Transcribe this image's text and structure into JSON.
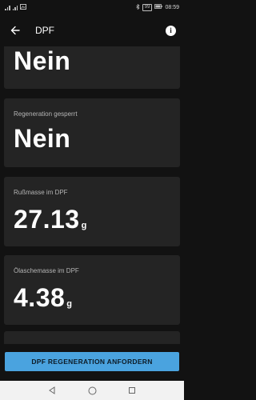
{
  "status_bar": {
    "battery": "99",
    "time": "08:59"
  },
  "app_bar": {
    "title": "DPF",
    "back_icon": "arrow-left-icon",
    "info_icon": "info-icon"
  },
  "cards": [
    {
      "label": "",
      "value": "Nein",
      "unit": ""
    },
    {
      "label": "Regeneration gesperrt",
      "value": "Nein",
      "unit": ""
    },
    {
      "label": "Rußmasse im DPF",
      "value": "27.13",
      "unit": "g"
    },
    {
      "label": "Ölaschemasse im DPF",
      "value": "4.38",
      "unit": "g"
    }
  ],
  "action": {
    "label": "DPF REGENERATION ANFORDERN",
    "color": "#4aa3df"
  },
  "nav_bar": {
    "back_icon": "triangle-back-icon",
    "home_icon": "circle-home-icon",
    "recents_icon": "square-recents-icon"
  },
  "colors": {
    "background": "#121212",
    "card": "#242424",
    "accent": "#4aa3df"
  }
}
